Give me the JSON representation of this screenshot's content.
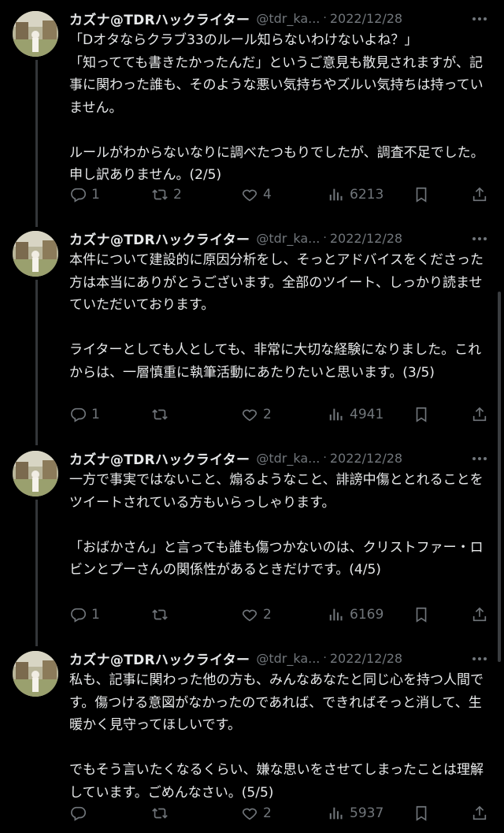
{
  "tweets": [
    {
      "name": "カズナ@TDRハックライター",
      "handle": "@tdr_ka...",
      "separator": "·",
      "date": "2022/12/28",
      "text": "「Dオタならクラブ33のルール知らないわけないよね？」\n「知ってても書きたかったんだ」というご意見も散見されますが、記事に関わった誰も、そのような悪い気持ちやズルい気持ちは持っていません。\n\nルールがわからないなりに調べたつもりでしたが、調査不足でした。申し訳ありません。(2/5)",
      "replies": "1",
      "retweets": "2",
      "likes": "4",
      "views": "6213"
    },
    {
      "name": "カズナ@TDRハックライター",
      "handle": "@tdr_ka...",
      "separator": "·",
      "date": "2022/12/28",
      "text": "本件について建設的に原因分析をし、そっとアドバイスをくださった方は本当にありがとうございます。全部のツイート、しっかり読ませていただいております。\n\nライターとしても人としても、非常に大切な経験になりました。これからは、一層慎重に執筆活動にあたりたいと思います。(3/5)",
      "replies": "1",
      "retweets": "",
      "likes": "2",
      "views": "4941"
    },
    {
      "name": "カズナ@TDRハックライター",
      "handle": "@tdr_ka...",
      "separator": "·",
      "date": "2022/12/28",
      "text": "一方で事実ではないこと、煽るようなこと、誹謗中傷ととれることをツイートされている方もいらっしゃります。\n\n「おばかさん」と言っても誰も傷つかないのは、クリストファー・ロビンとプーさんの関係性があるときだけです。(4/5)",
      "replies": "1",
      "retweets": "",
      "likes": "2",
      "views": "6169"
    },
    {
      "name": "カズナ@TDRハックライター",
      "handle": "@tdr_ka...",
      "separator": "·",
      "date": "2022/12/28",
      "text": "私も、記事に関わった他の方も、みんなあなたと同じ心を持つ人間です。傷つける意図がなかったのであれば、できればそっと消して、生暖かく見守ってほしいです。\n\nでもそう言いたくなるくらい、嫌な思いをさせてしまったことは理解しています。ごめんなさい。(5/5)",
      "replies": "",
      "retweets": "",
      "likes": "2",
      "views": "5937"
    }
  ],
  "icons": {
    "reply": "reply-icon",
    "retweet": "retweet-icon",
    "like": "heart-icon",
    "views": "views-icon",
    "bookmark": "bookmark-icon",
    "share": "share-icon",
    "more": "more-icon"
  },
  "colors": {
    "background": "#000000",
    "text": "#e7e9ea",
    "muted": "#71767b"
  }
}
